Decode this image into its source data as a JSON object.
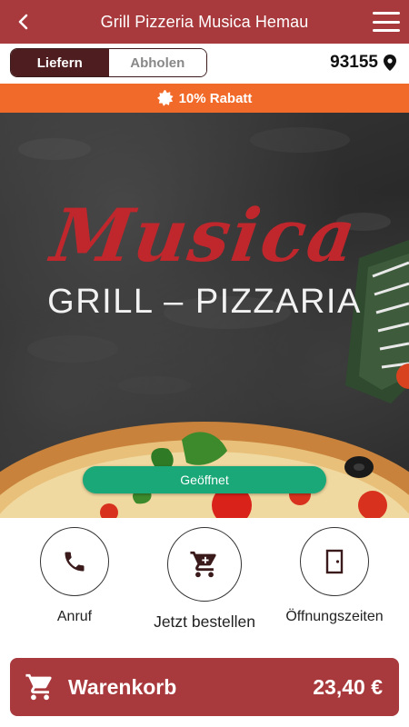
{
  "header": {
    "title": "Grill Pizzeria Musica Hemau",
    "back_icon": "chevron-left-icon",
    "menu_icon": "hamburger-menu-icon"
  },
  "mode_toggle": {
    "options": [
      {
        "label": "Liefern",
        "active": true
      },
      {
        "label": "Abholen",
        "active": false
      }
    ]
  },
  "location": {
    "zip": "93155",
    "icon": "map-pin-icon"
  },
  "promo": {
    "icon": "badge-star-icon",
    "text": "10% Rabatt"
  },
  "hero": {
    "logo_script": "Musica",
    "logo_subtitle": "GRILL – PIZZARIA",
    "status": "Geöffnet",
    "status_color": "#1aa878"
  },
  "actions": [
    {
      "label": "Anruf",
      "icon": "phone-icon"
    },
    {
      "label": "Jetzt bestellen",
      "icon": "shopping-cart-icon"
    },
    {
      "label": "Öffnungszeiten",
      "icon": "door-icon"
    }
  ],
  "cart": {
    "label": "Warenkorb",
    "total": "23,40 €",
    "icon": "shopping-cart-icon"
  },
  "colors": {
    "brand": "#a8393c",
    "toggle_active": "#4e1d1f",
    "promo": "#f26a2a",
    "status_open": "#1aa878"
  }
}
